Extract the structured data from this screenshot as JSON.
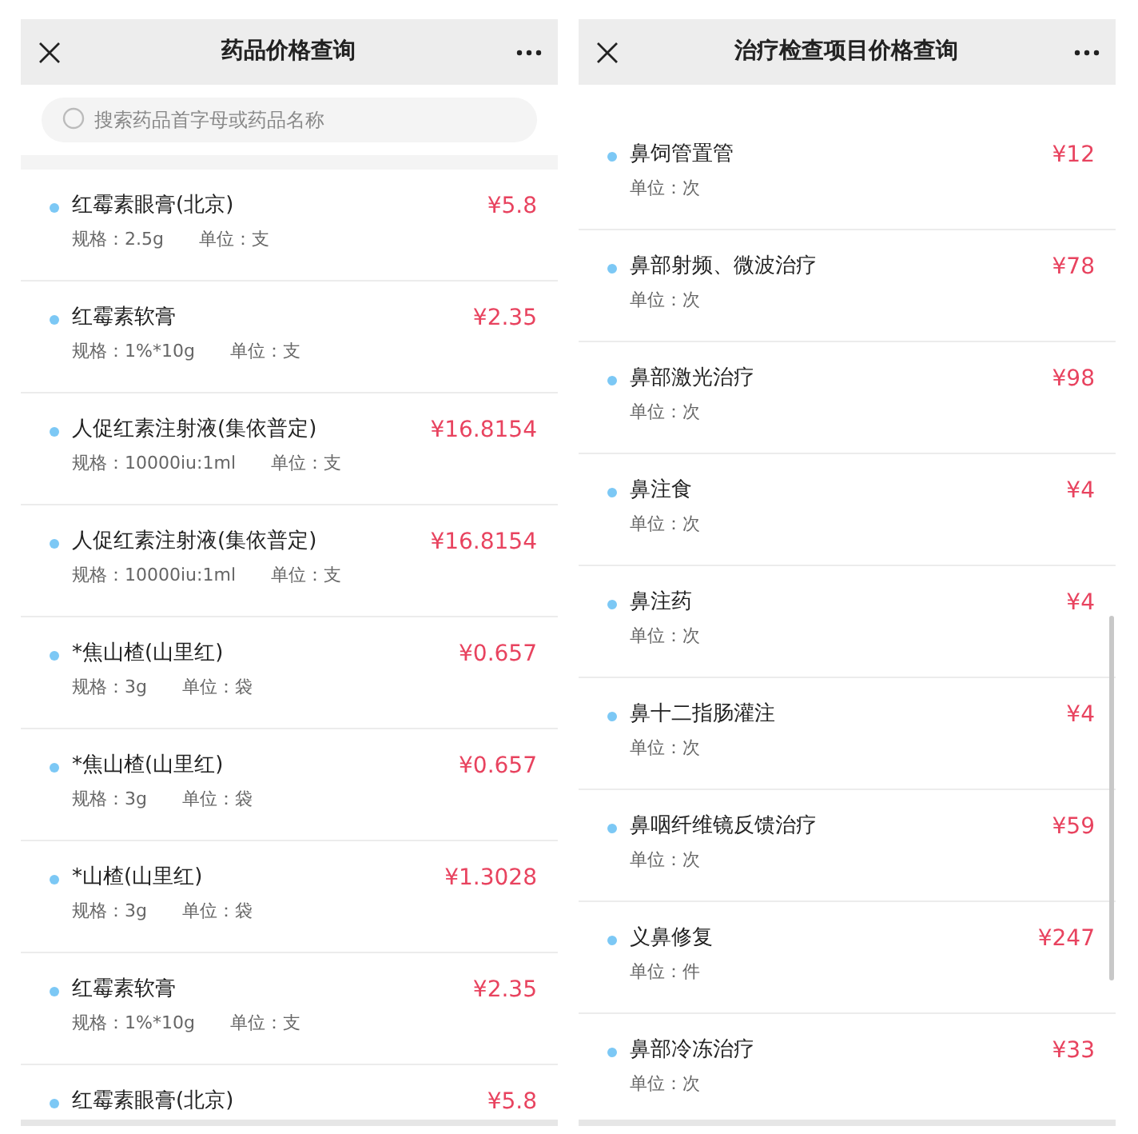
{
  "panels": [
    {
      "title": "药品价格查询",
      "search": {
        "placeholder": "搜索药品首字母或药品名称"
      },
      "scrollbar": false,
      "items": [
        {
          "name": "红霉素眼膏(北京)",
          "price": "¥5.8",
          "spec": "规格：2.5g",
          "unit": "单位：支"
        },
        {
          "name": "红霉素软膏",
          "price": "¥2.35",
          "spec": "规格：1%*10g",
          "unit": "单位：支"
        },
        {
          "name": "人促红素注射液(集依普定)",
          "price": "¥16.8154",
          "spec": "规格：10000iu:1ml",
          "unit": "单位：支"
        },
        {
          "name": "人促红素注射液(集依普定)",
          "price": "¥16.8154",
          "spec": "规格：10000iu:1ml",
          "unit": "单位：支"
        },
        {
          "name": "*焦山楂(山里红)",
          "price": "¥0.657",
          "spec": "规格：3g",
          "unit": "单位：袋"
        },
        {
          "name": "*焦山楂(山里红)",
          "price": "¥0.657",
          "spec": "规格：3g",
          "unit": "单位：袋"
        },
        {
          "name": "*山楂(山里红)",
          "price": "¥1.3028",
          "spec": "规格：3g",
          "unit": "单位：袋"
        },
        {
          "name": "红霉素软膏",
          "price": "¥2.35",
          "spec": "规格：1%*10g",
          "unit": "单位：支"
        },
        {
          "name": "红霉素眼膏(北京)",
          "price": "¥5.8"
        }
      ]
    },
    {
      "title": "治疗检查项目价格查询",
      "scrollbar": true,
      "items": [
        {
          "name": "鼻饲管置管",
          "price": "¥12",
          "unit": "单位：次"
        },
        {
          "name": "鼻部射频、微波治疗",
          "price": "¥78",
          "unit": "单位：次"
        },
        {
          "name": "鼻部激光治疗",
          "price": "¥98",
          "unit": "单位：次"
        },
        {
          "name": "鼻注食",
          "price": "¥4",
          "unit": "单位：次"
        },
        {
          "name": "鼻注药",
          "price": "¥4",
          "unit": "单位：次"
        },
        {
          "name": "鼻十二指肠灌注",
          "price": "¥4",
          "unit": "单位：次"
        },
        {
          "name": "鼻咽纤维镜反馈治疗",
          "price": "¥59",
          "unit": "单位：次"
        },
        {
          "name": "义鼻修复",
          "price": "¥247",
          "unit": "单位：件"
        },
        {
          "name": "鼻部冷冻治疗",
          "price": "¥33",
          "unit": "单位：次"
        }
      ]
    }
  ]
}
